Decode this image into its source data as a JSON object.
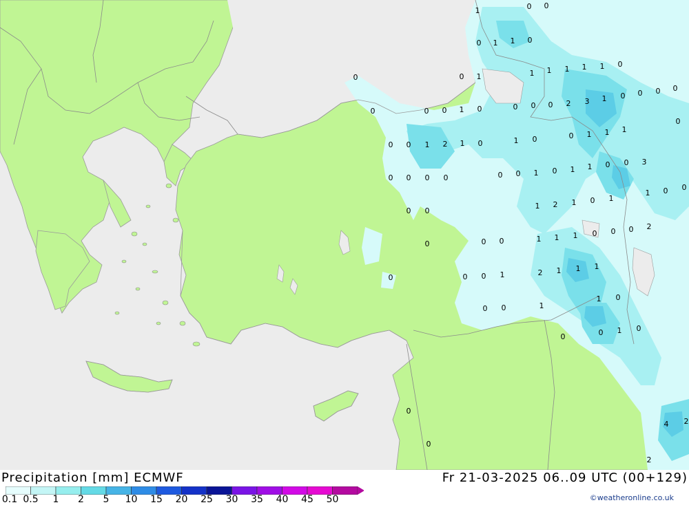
{
  "map": {
    "colors": {
      "sea": "#ececec",
      "land": "#c0f594",
      "border": "#8a8a8a",
      "coast": "#9a9a9a"
    },
    "shading": [
      {
        "band": "0.1",
        "color": "#d6fafa"
      },
      {
        "band": "0.5",
        "color": "#a8f0f2"
      },
      {
        "band": "1",
        "color": "#7ae0ea"
      },
      {
        "band": "2",
        "color": "#5ccde6"
      }
    ],
    "labels": [
      {
        "text": "1"
      },
      {
        "text": "0"
      },
      {
        "text": "0"
      },
      {
        "text": "0"
      },
      {
        "text": "1"
      },
      {
        "text": "1"
      },
      {
        "text": "0"
      },
      {
        "text": "0"
      },
      {
        "text": "0"
      },
      {
        "text": "1"
      },
      {
        "text": "1"
      },
      {
        "text": "1"
      },
      {
        "text": "1"
      },
      {
        "text": "1"
      },
      {
        "text": "1"
      },
      {
        "text": "0"
      },
      {
        "text": "0"
      },
      {
        "text": "0"
      },
      {
        "text": "0"
      },
      {
        "text": "0"
      },
      {
        "text": "0"
      },
      {
        "text": "0"
      },
      {
        "text": "1"
      },
      {
        "text": "0"
      },
      {
        "text": "0"
      },
      {
        "text": "0"
      },
      {
        "text": "0"
      },
      {
        "text": "2"
      },
      {
        "text": "3"
      },
      {
        "text": "1"
      },
      {
        "text": "0"
      },
      {
        "text": "0"
      },
      {
        "text": "0"
      },
      {
        "text": "0"
      },
      {
        "text": "1"
      },
      {
        "text": "2"
      },
      {
        "text": "1"
      },
      {
        "text": "0"
      },
      {
        "text": "1"
      },
      {
        "text": "0"
      },
      {
        "text": "0"
      },
      {
        "text": "1"
      },
      {
        "text": "1"
      },
      {
        "text": "1"
      },
      {
        "text": "0"
      },
      {
        "text": "0"
      },
      {
        "text": "0"
      },
      {
        "text": "0"
      },
      {
        "text": "0"
      },
      {
        "text": "0"
      },
      {
        "text": "1"
      },
      {
        "text": "0"
      },
      {
        "text": "1"
      },
      {
        "text": "1"
      },
      {
        "text": "0"
      },
      {
        "text": "0"
      },
      {
        "text": "3"
      },
      {
        "text": "1"
      },
      {
        "text": "0"
      },
      {
        "text": "0"
      },
      {
        "text": "0"
      },
      {
        "text": "0"
      },
      {
        "text": "1"
      },
      {
        "text": "2"
      },
      {
        "text": "1"
      },
      {
        "text": "0"
      },
      {
        "text": "1"
      },
      {
        "text": "0"
      },
      {
        "text": "0"
      },
      {
        "text": "0"
      },
      {
        "text": "1"
      },
      {
        "text": "1"
      },
      {
        "text": "1"
      },
      {
        "text": "0"
      },
      {
        "text": "0"
      },
      {
        "text": "0"
      },
      {
        "text": "2"
      },
      {
        "text": "0"
      },
      {
        "text": "0"
      },
      {
        "text": "1"
      },
      {
        "text": "2"
      },
      {
        "text": "1"
      },
      {
        "text": "1"
      },
      {
        "text": "1"
      },
      {
        "text": "0"
      },
      {
        "text": "0"
      },
      {
        "text": "0"
      },
      {
        "text": "1"
      },
      {
        "text": "1"
      },
      {
        "text": "0"
      },
      {
        "text": "0"
      },
      {
        "text": "0"
      },
      {
        "text": "1"
      },
      {
        "text": "0"
      },
      {
        "text": "0"
      },
      {
        "text": "0"
      },
      {
        "text": "4"
      },
      {
        "text": "2"
      },
      {
        "text": "2"
      }
    ]
  },
  "footer": {
    "title_left": "Precipitation [mm] ECMWF",
    "title_right": "Fr 21-03-2025 06..09 UTC (00+129)",
    "credit": "©weatheronline.co.uk",
    "scale": [
      {
        "label": "0.1",
        "color": "#e6fdfd"
      },
      {
        "label": "0.5",
        "color": "#c4f6f6"
      },
      {
        "label": "1",
        "color": "#96eeee"
      },
      {
        "label": "2",
        "color": "#64dae6"
      },
      {
        "label": "5",
        "color": "#46b4e6"
      },
      {
        "label": "10",
        "color": "#2e8ce6"
      },
      {
        "label": "15",
        "color": "#1e5ae0"
      },
      {
        "label": "20",
        "color": "#1432c8"
      },
      {
        "label": "25",
        "color": "#0a1496"
      },
      {
        "label": "30",
        "color": "#7a14e6"
      },
      {
        "label": "35",
        "color": "#a00ee6"
      },
      {
        "label": "40",
        "color": "#d20ae6"
      },
      {
        "label": "45",
        "color": "#e60ad2"
      },
      {
        "label": "50",
        "color": "#b40aa0"
      }
    ]
  }
}
